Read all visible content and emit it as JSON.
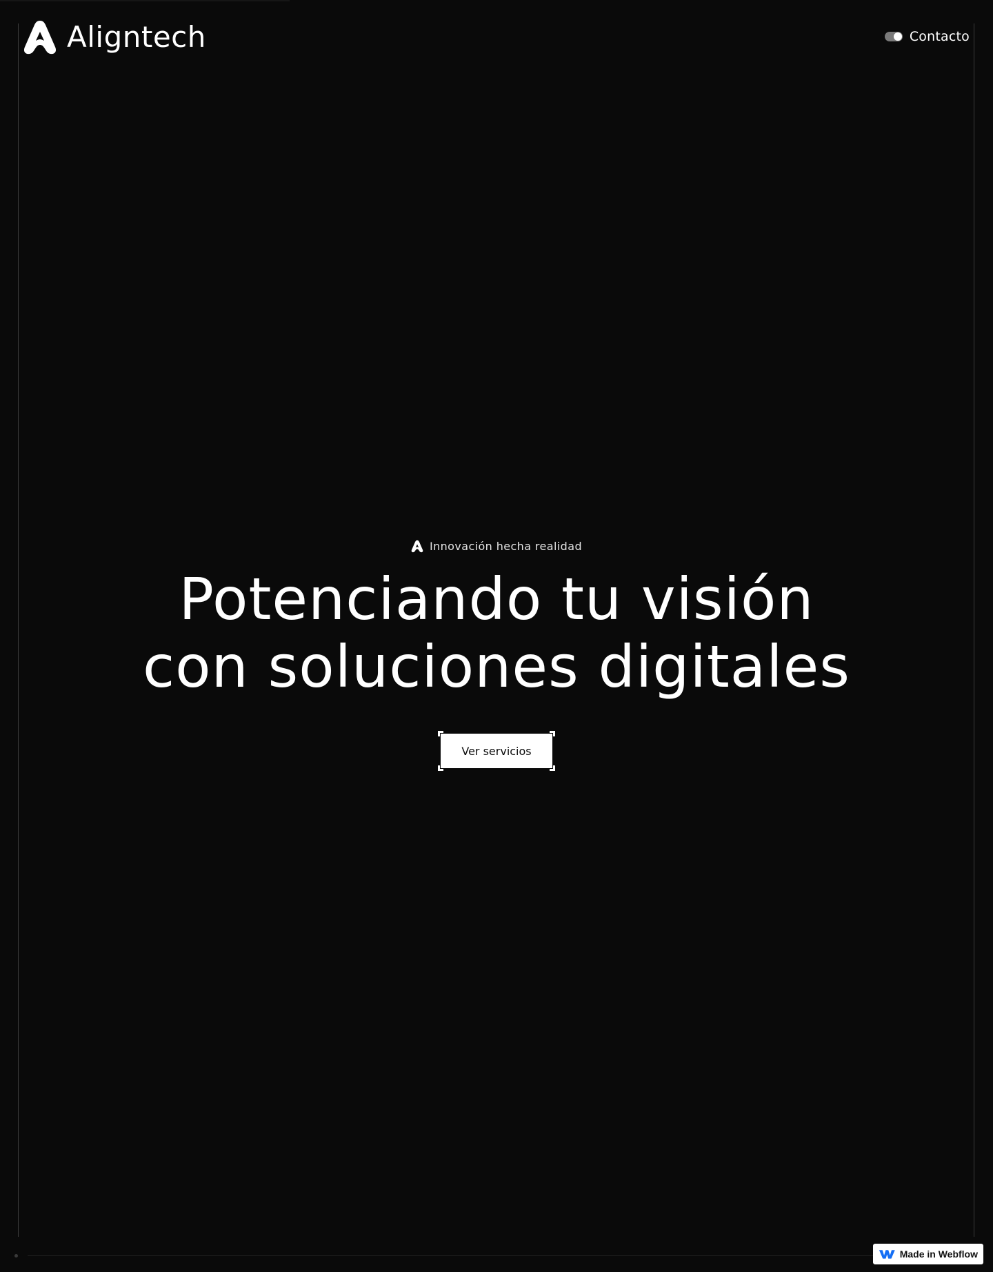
{
  "brand": {
    "name": "Aligntech",
    "logo_icon": "a-logo-icon"
  },
  "nav": {
    "contact_label": "Contacto",
    "toggle_icon": "toggle-icon"
  },
  "hero": {
    "eyebrow": "Innovación hecha realidad",
    "headline_line1": "Potenciando tu visión",
    "headline_line2": "con soluciones digitales",
    "cta_label": "Ver servicios"
  },
  "badge": {
    "label": "Made in Webflow",
    "icon": "webflow-icon",
    "accent": "#146ef5"
  },
  "colors": {
    "background": "#0a0a0a",
    "text": "#ffffff",
    "frame_line": "#3c3c3c"
  }
}
